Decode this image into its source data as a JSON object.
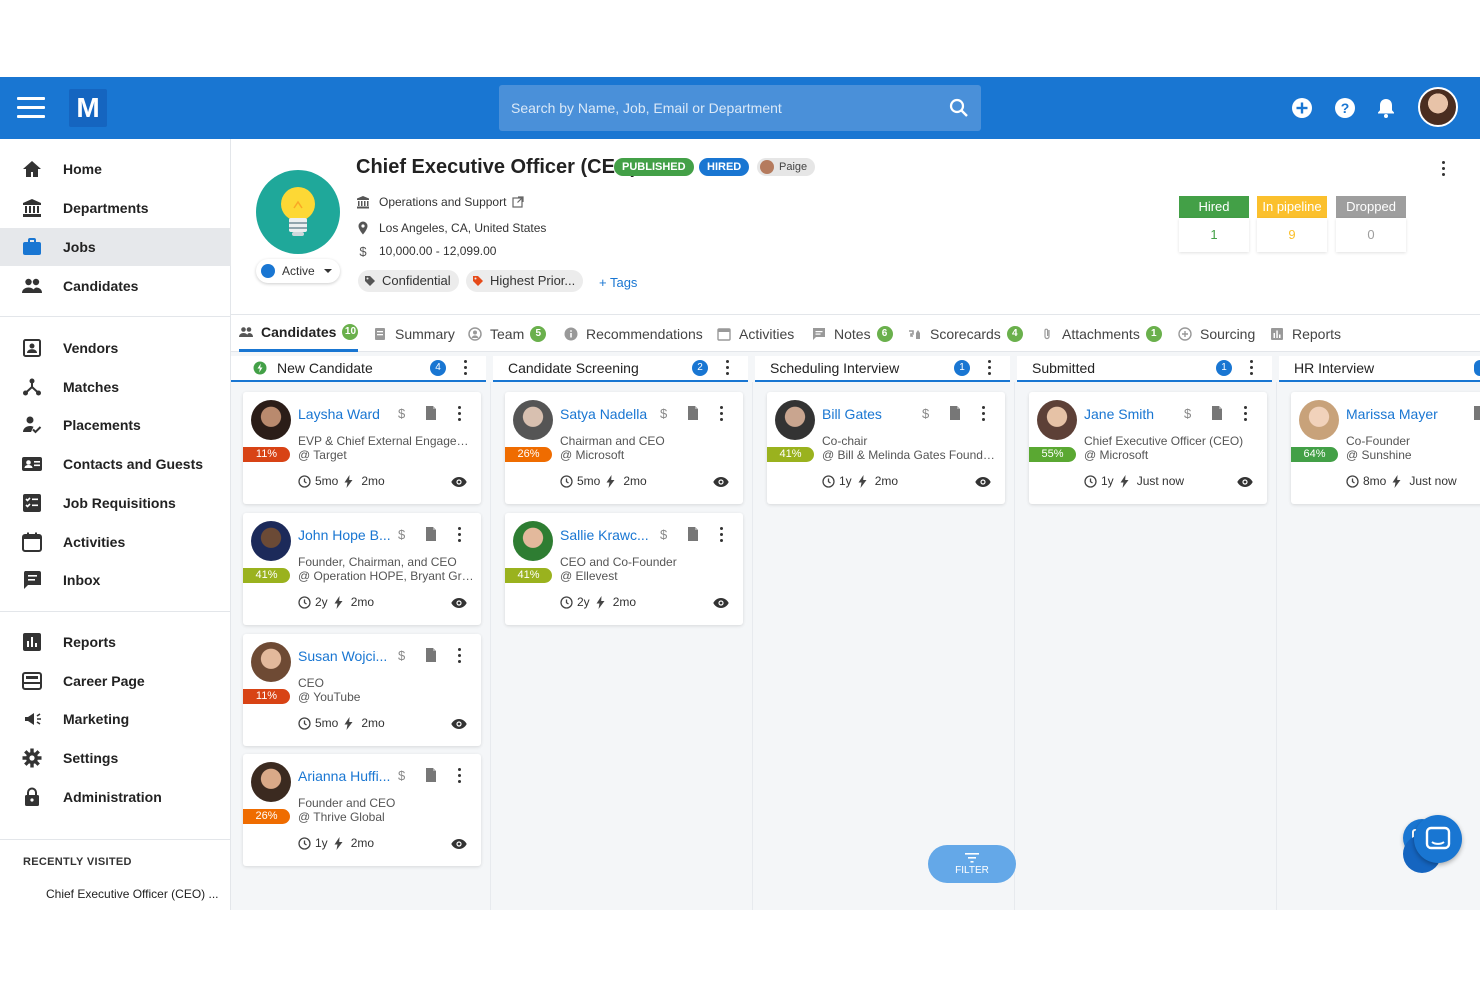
{
  "topbar": {
    "logo": "M",
    "search_placeholder": "Search by Name, Job, Email or Department"
  },
  "sidebar": {
    "items": [
      {
        "label": "Home",
        "icon": "home-icon"
      },
      {
        "label": "Departments",
        "icon": "bank-icon"
      },
      {
        "label": "Jobs",
        "icon": "briefcase-icon"
      },
      {
        "label": "Candidates",
        "icon": "people-icon"
      },
      {
        "label": "Vendors",
        "icon": "vendor-icon"
      },
      {
        "label": "Matches",
        "icon": "matches-icon"
      },
      {
        "label": "Placements",
        "icon": "placement-icon"
      },
      {
        "label": "Contacts and Guests",
        "icon": "contacts-icon"
      },
      {
        "label": "Job Requisitions",
        "icon": "requisition-icon"
      },
      {
        "label": "Activities",
        "icon": "calendar-icon"
      },
      {
        "label": "Inbox",
        "icon": "inbox-icon"
      },
      {
        "label": "Reports",
        "icon": "chart-icon"
      },
      {
        "label": "Career Page",
        "icon": "career-icon"
      },
      {
        "label": "Marketing",
        "icon": "megaphone-icon"
      },
      {
        "label": "Settings",
        "icon": "gear-icon"
      },
      {
        "label": "Administration",
        "icon": "lock-icon"
      }
    ],
    "active": "Jobs",
    "recent_title": "RECENTLY VISITED",
    "recent_item": "Chief Executive Officer (CEO) ..."
  },
  "job": {
    "title": "Chief Executive Officer (CEO)",
    "badge_published": "PUBLISHED",
    "badge_hired": "HIRED",
    "owner": "Paige",
    "department": "Operations and Support",
    "location": "Los Angeles, CA, United States",
    "salary": "10,000.00 - 12,099.00",
    "status": "Active",
    "tags": [
      "Confidential",
      "Highest Prior..."
    ],
    "add_tag": "+ Tags",
    "stats": [
      {
        "label": "Hired",
        "value": "1",
        "color": "#43a047"
      },
      {
        "label": "In pipeline",
        "value": "9",
        "color": "#fbc02d"
      },
      {
        "label": "Dropped",
        "value": "0",
        "color": "#9e9e9e"
      }
    ]
  },
  "tabs": [
    {
      "label": "Candidates",
      "count": "10"
    },
    {
      "label": "Summary",
      "count": ""
    },
    {
      "label": "Team",
      "count": "5"
    },
    {
      "label": "Recommendations",
      "count": ""
    },
    {
      "label": "Activities",
      "count": ""
    },
    {
      "label": "Notes",
      "count": "6"
    },
    {
      "label": "Scorecards",
      "count": "4"
    },
    {
      "label": "Attachments",
      "count": "1"
    },
    {
      "label": "Sourcing",
      "count": ""
    },
    {
      "label": "Reports",
      "count": ""
    }
  ],
  "columns": [
    {
      "title": "New Candidate",
      "count": "4"
    },
    {
      "title": "Candidate Screening",
      "count": "2"
    },
    {
      "title": "Scheduling Interview",
      "count": "1"
    },
    {
      "title": "Submitted",
      "count": "1"
    },
    {
      "title": "HR Interview",
      "count": ""
    }
  ],
  "cards": [
    {
      "name": "Laysha Ward",
      "pct": "11%",
      "pct_color": "#d84315",
      "role": "EVP & Chief External Engageme...",
      "company": "@ Target",
      "t1": "5mo",
      "t2": "2mo",
      "dollar": "$"
    },
    {
      "name": "John Hope B...",
      "pct": "41%",
      "pct_color": "#9ab21e",
      "role": "Founder, Chairman, and CEO",
      "company": "@ Operation HOPE, Bryant Group...",
      "t1": "2y",
      "t2": "2mo",
      "dollar": "$"
    },
    {
      "name": "Susan Wojci...",
      "pct": "11%",
      "pct_color": "#d84315",
      "role": "CEO",
      "company": "@ YouTube",
      "t1": "5mo",
      "t2": "2mo",
      "dollar": "$"
    },
    {
      "name": "Arianna Huffi...",
      "pct": "26%",
      "pct_color": "#ef6c00",
      "role": "Founder and CEO",
      "company": "@ Thrive Global",
      "t1": "1y",
      "t2": "2mo",
      "dollar": "$"
    },
    {
      "name": "Satya Nadella",
      "pct": "26%",
      "pct_color": "#ef6c00",
      "role": "Chairman and CEO",
      "company": "@ Microsoft",
      "t1": "5mo",
      "t2": "2mo",
      "dollar": "$"
    },
    {
      "name": "Sallie Krawc...",
      "pct": "41%",
      "pct_color": "#9ab21e",
      "role": "CEO and Co-Founder",
      "company": "@ Ellevest",
      "t1": "2y",
      "t2": "2mo",
      "dollar": "$"
    },
    {
      "name": "Bill Gates",
      "pct": "41%",
      "pct_color": "#9ab21e",
      "role": "Co-chair",
      "company": "@ Bill & Melinda Gates Foundation",
      "t1": "1y",
      "t2": "2mo",
      "dollar": "$"
    },
    {
      "name": "Jane Smith",
      "pct": "55%",
      "pct_color": "#5aa832",
      "role": "Chief Executive Officer (CEO)",
      "company": "@ Microsoft",
      "t1": "1y",
      "t2": "Just now",
      "dollar": "$"
    },
    {
      "name": "Marissa Mayer",
      "pct": "64%",
      "pct_color": "#43a047",
      "role": "Co-Founder",
      "company": "@ Sunshine",
      "t1": "8mo",
      "t2": "Just now",
      "dollar": ""
    }
  ],
  "filter_label": "FILTER"
}
